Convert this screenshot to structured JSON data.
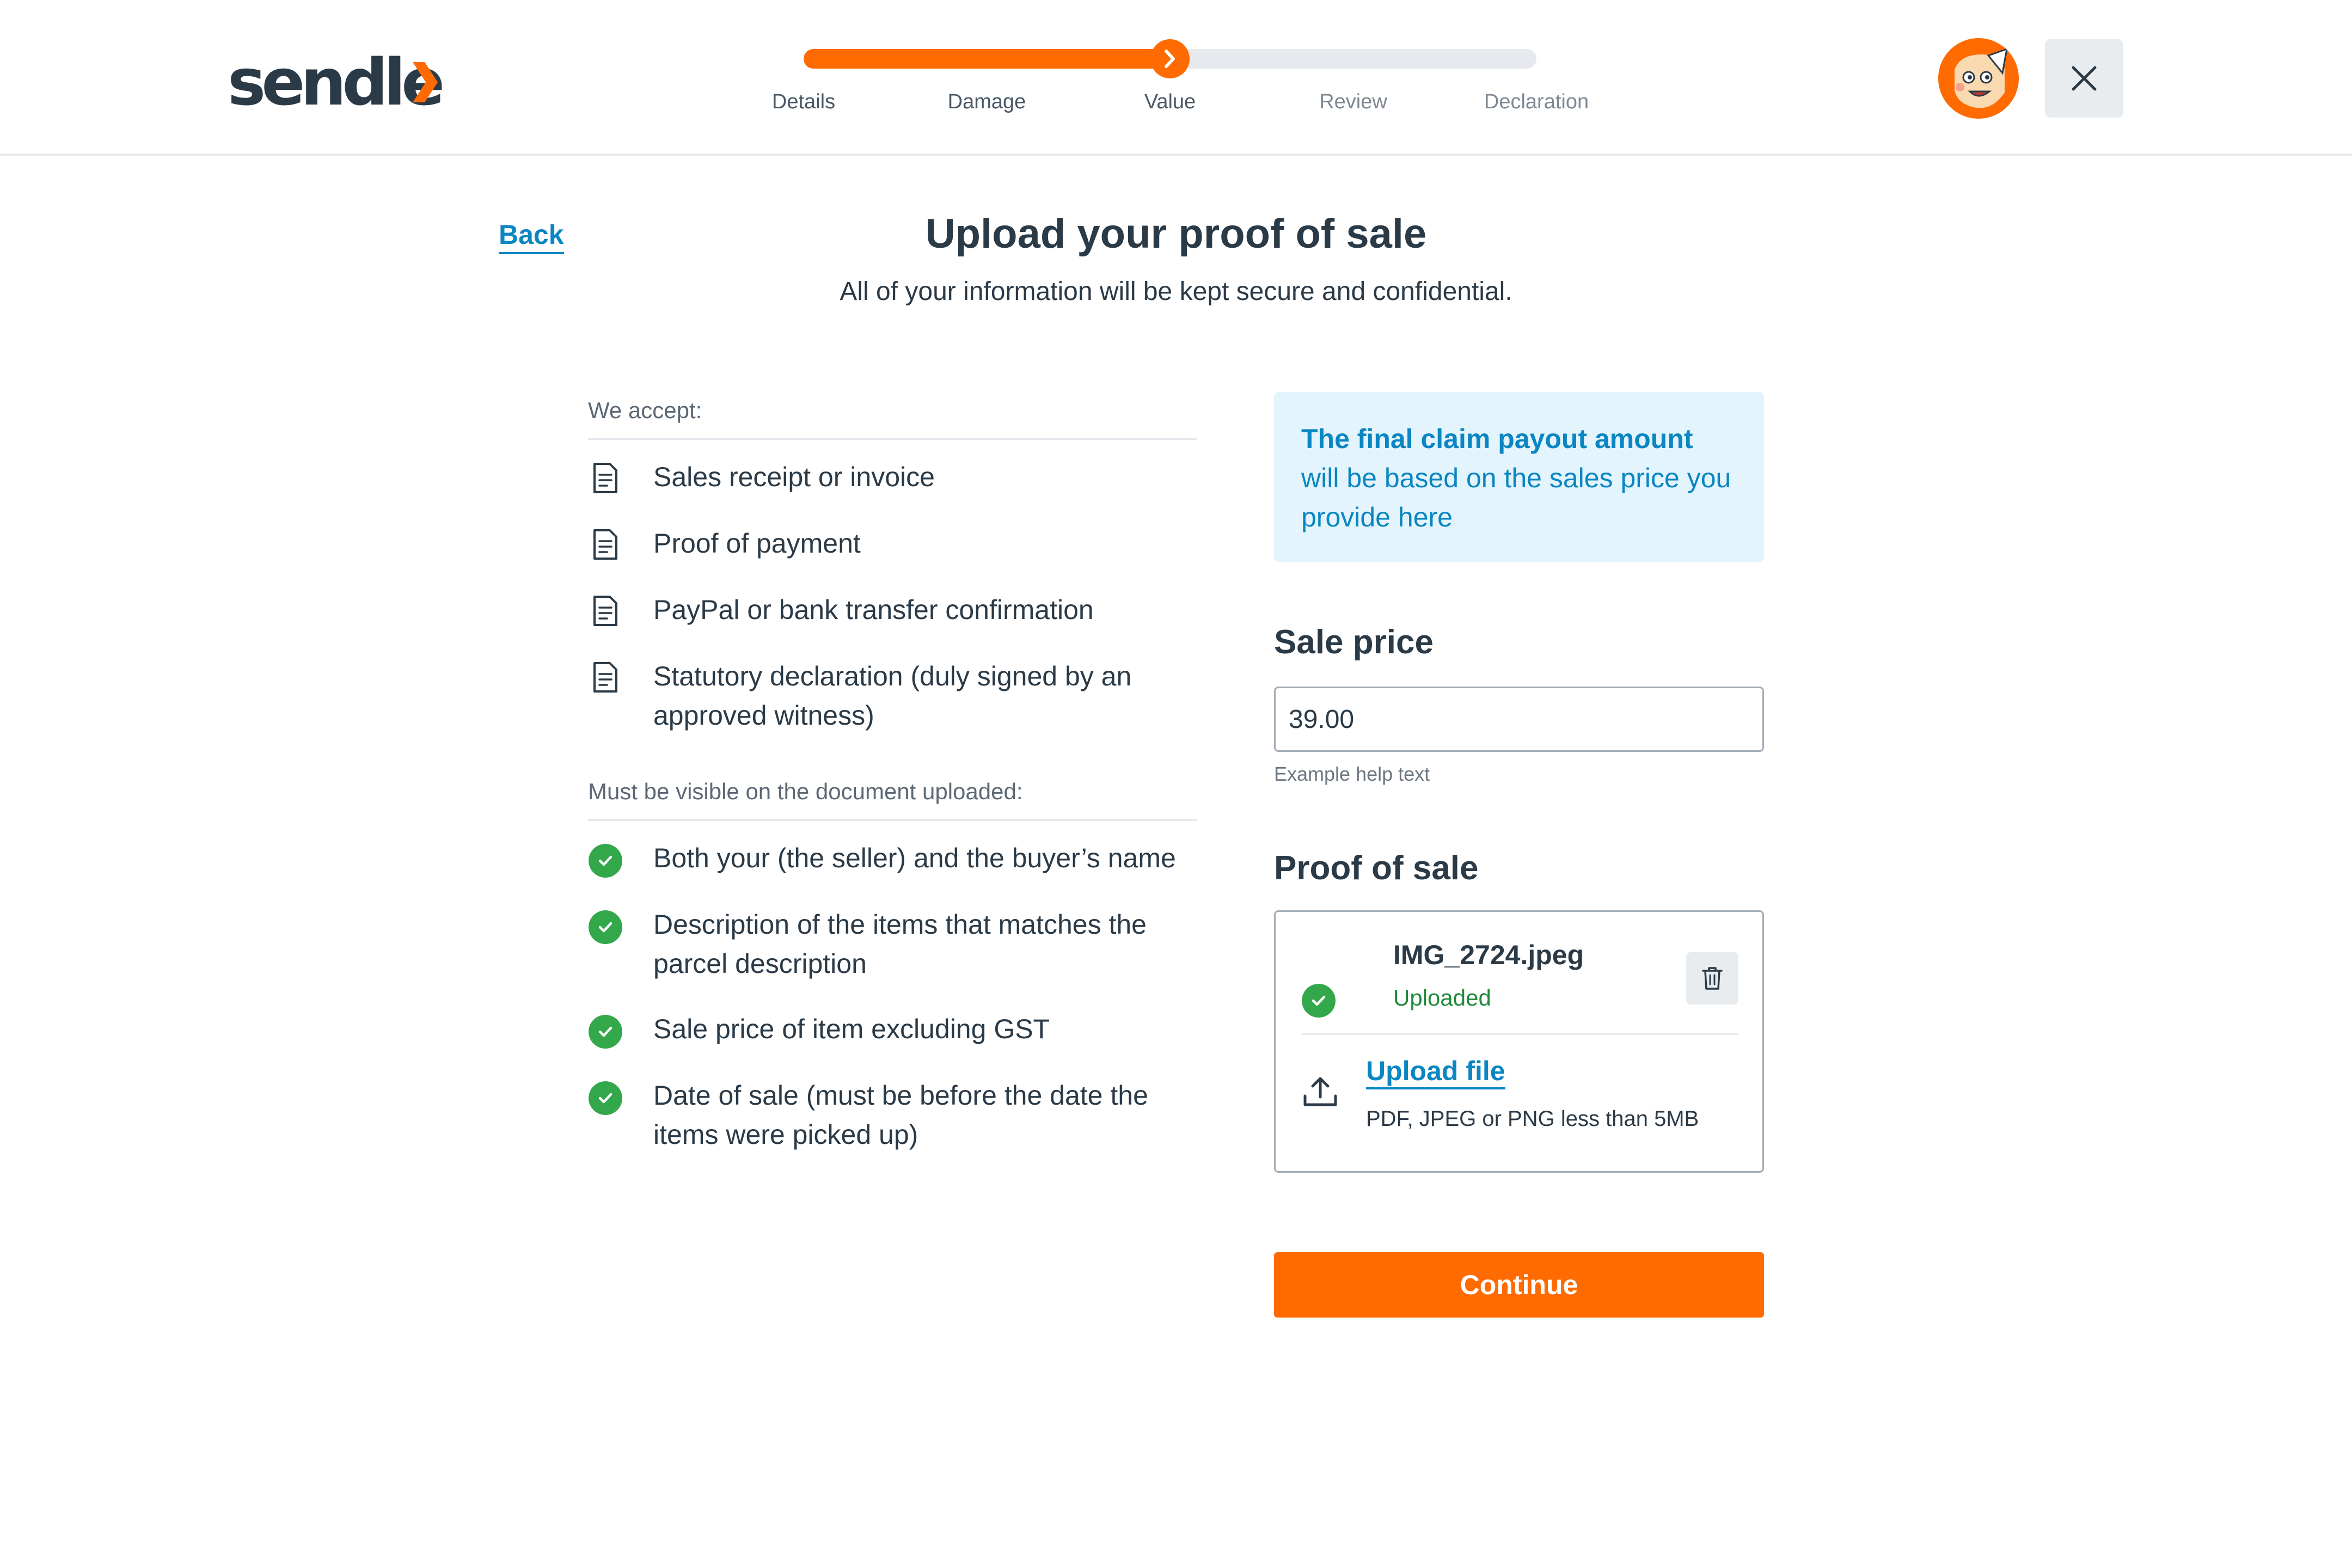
{
  "app": {
    "logo_text": "sendle",
    "brand_color": "#ff6b00",
    "link_color": "#0a86c2"
  },
  "progress": {
    "steps": [
      "Details",
      "Damage",
      "Value",
      "Review",
      "Declaration"
    ],
    "current_step": 3,
    "fill_fraction": 0.5
  },
  "header": {
    "avatar_icon": "avatar-icon",
    "close_icon": "close-icon"
  },
  "page": {
    "back_label": "Back",
    "title": "Upload your proof of sale",
    "subtitle": "All of your information will be kept secure and confidential."
  },
  "accept": {
    "heading": "We accept:",
    "items": [
      "Sales receipt or invoice",
      "Proof of payment",
      "PayPal or bank transfer confirmation",
      "Statutory declaration (duly signed by an approved witness)"
    ]
  },
  "visible": {
    "heading": "Must be visible on the document uploaded:",
    "items": [
      "Both your (the seller) and the buyer’s name",
      "Description of the items that matches the parcel description",
      "Sale price of item excluding GST",
      "Date of sale (must be before the date the items were picked up)"
    ]
  },
  "info": {
    "bold": "The final claim payout amount",
    "rest": " will be based on the sales price you provide here"
  },
  "sale_price": {
    "label": "Sale price",
    "value": "39.00",
    "help": "Example help text"
  },
  "proof": {
    "label": "Proof of sale",
    "file_name": "IMG_2724.jpeg",
    "file_status": "Uploaded",
    "upload_label": "Upload file",
    "upload_hint": "PDF, JPEG or PNG less than 5MB"
  },
  "continue_label": "Continue"
}
